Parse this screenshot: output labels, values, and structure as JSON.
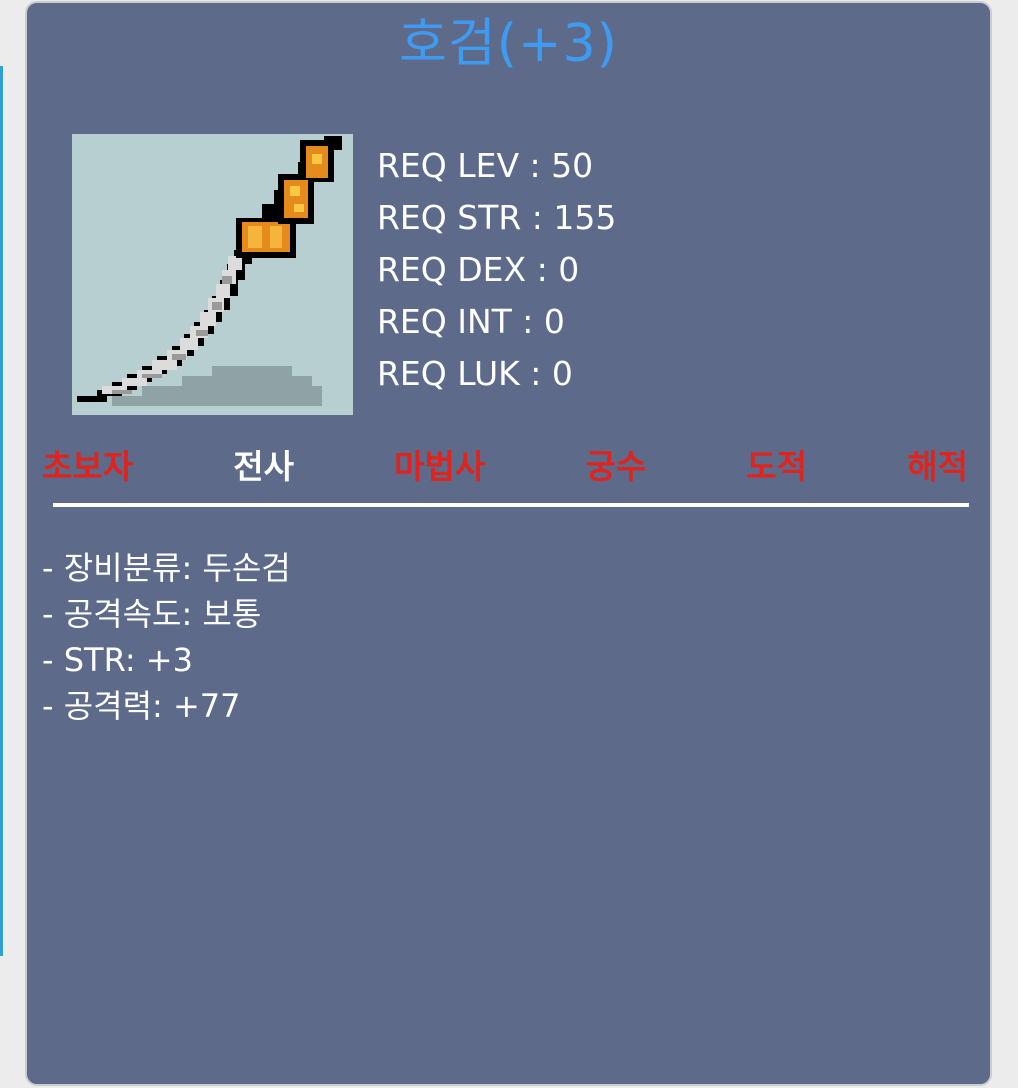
{
  "item": {
    "title": "호검(+3)",
    "icon": "sword-icon",
    "title_color": "#3f9bf2"
  },
  "requirements": [
    "REQ LEV : 50",
    "REQ STR : 155",
    "REQ DEX : 0",
    "REQ INT : 0",
    "REQ LUK : 0"
  ],
  "jobs": [
    {
      "label": "초보자",
      "equippable": false
    },
    {
      "label": "전사",
      "equippable": true
    },
    {
      "label": "마법사",
      "equippable": false
    },
    {
      "label": "궁수",
      "equippable": false
    },
    {
      "label": "도적",
      "equippable": false
    },
    {
      "label": "해적",
      "equippable": false
    }
  ],
  "colors": {
    "panel": "#5d6a8a",
    "restricted_job": "#e0231c",
    "allowed_job": "#ffffff"
  },
  "stats": [
    "- 장비분류: 두손검",
    "- 공격속도: 보통",
    "- STR: +3",
    "- 공격력: +77"
  ]
}
